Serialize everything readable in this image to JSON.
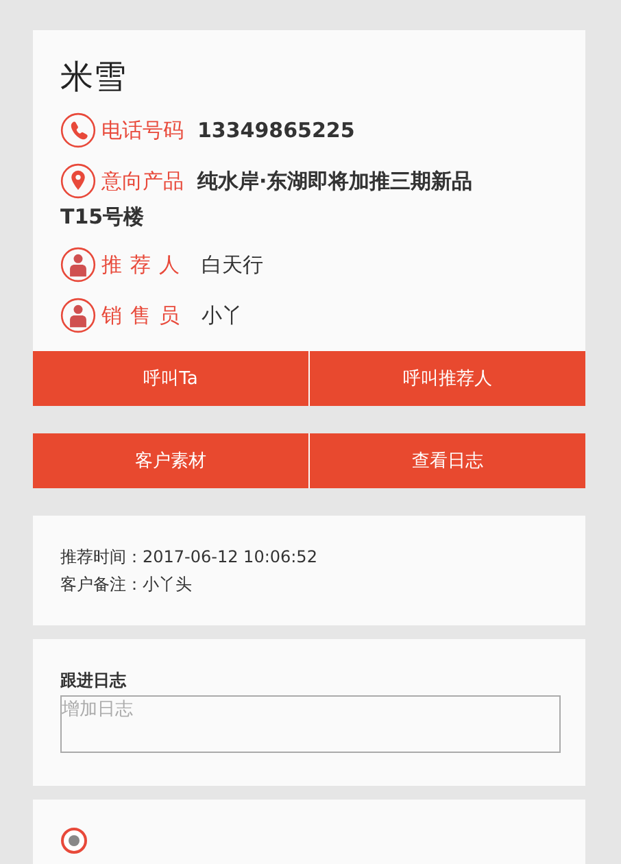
{
  "customer": {
    "name": "米雪",
    "fields": [
      {
        "kind": "phone",
        "label": "电话号码",
        "value": "13349865225",
        "bold": true
      },
      {
        "kind": "location",
        "label": "意向产品",
        "value": "纯水岸·东湖即将加推三期新品",
        "value_continued": "T15号楼",
        "bold": true
      },
      {
        "kind": "person",
        "label": "推荐人",
        "value": "白天行",
        "bold": false
      },
      {
        "kind": "person",
        "label": "销售员",
        "value": "小丫",
        "bold": false
      }
    ]
  },
  "button_rows": [
    [
      "呼叫Ta",
      "呼叫推荐人"
    ],
    [
      "客户素材",
      "查看日志"
    ]
  ],
  "details": [
    {
      "label": "推荐时间：",
      "value": "2017-06-12 10:06:52"
    },
    {
      "label": "客户备注：",
      "value": "小丫头"
    }
  ],
  "follow_log": {
    "title": "跟进日志",
    "placeholder": "增加日志"
  }
}
